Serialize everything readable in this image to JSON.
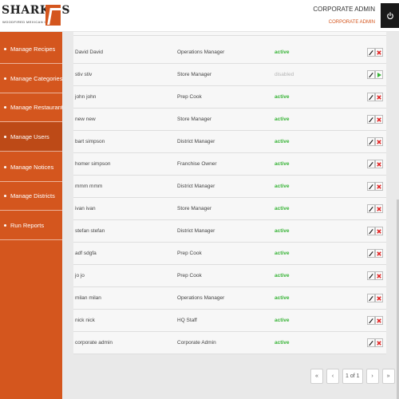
{
  "header": {
    "logo_text": "SHARKY'S",
    "logo_subtitle": "WOODFIRED MEXICAN GRILL",
    "user_role_title": "CORPORATE ADMIN",
    "user_role_subtitle": "CORPORATE ADMIN",
    "power_icon": "power-icon"
  },
  "sidebar": {
    "items": [
      {
        "label": "Manage Recipes"
      },
      {
        "label": "Manage Categories"
      },
      {
        "label": "Manage Restaurants"
      },
      {
        "label": "Manage Users",
        "active": true
      },
      {
        "label": "Manage Notices"
      },
      {
        "label": "Manage Districts"
      },
      {
        "label": "Run Reports"
      }
    ]
  },
  "users_table": {
    "rows": [
      {
        "name": "David David",
        "role": "Operations Manager",
        "status": "active",
        "toggle_icon": "delete-icon"
      },
      {
        "name": "stiv stiv",
        "role": "Store Manager",
        "status": "disabled",
        "toggle_icon": "activate-icon"
      },
      {
        "name": "john john",
        "role": "Prep Cook",
        "status": "active",
        "toggle_icon": "delete-icon"
      },
      {
        "name": "new new",
        "role": "Store Manager",
        "status": "active",
        "toggle_icon": "delete-icon"
      },
      {
        "name": "bart simpson",
        "role": "District Manager",
        "status": "active",
        "toggle_icon": "delete-icon"
      },
      {
        "name": "homer simpson",
        "role": "Franchise Owner",
        "status": "active",
        "toggle_icon": "delete-icon"
      },
      {
        "name": "mmm mmm",
        "role": "District Manager",
        "status": "active",
        "toggle_icon": "delete-icon"
      },
      {
        "name": "ivan ivan",
        "role": "Store Manager",
        "status": "active",
        "toggle_icon": "delete-icon"
      },
      {
        "name": "stefan stefan",
        "role": "District Manager",
        "status": "active",
        "toggle_icon": "delete-icon"
      },
      {
        "name": "adf sdgfa",
        "role": "Prep Cook",
        "status": "active",
        "toggle_icon": "delete-icon"
      },
      {
        "name": "jo jo",
        "role": "Prep Cook",
        "status": "active",
        "toggle_icon": "delete-icon"
      },
      {
        "name": "milan milan",
        "role": "Operations Manager",
        "status": "active",
        "toggle_icon": "delete-icon"
      },
      {
        "name": "nick nick",
        "role": "HQ Staff",
        "status": "active",
        "toggle_icon": "delete-icon"
      },
      {
        "name": "corporate admin",
        "role": "Corporate Admin",
        "status": "active",
        "toggle_icon": "delete-icon"
      }
    ]
  },
  "pagination": {
    "first_label": "«",
    "prev_label": "‹",
    "page_info": "1 of 1",
    "next_label": "›",
    "last_label": "»"
  },
  "colors": {
    "brand_orange": "#d4561e",
    "active_green": "#36b335",
    "disabled_gray": "#b5b5b5",
    "delete_red": "#e02020"
  }
}
